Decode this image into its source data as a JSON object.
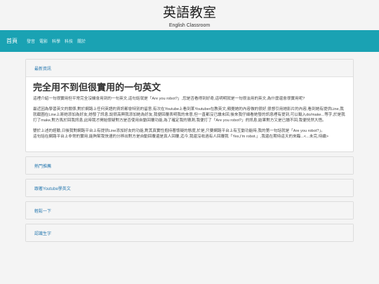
{
  "header": {
    "title": "英語教室",
    "subtitle": "English Classroom"
  },
  "nav": {
    "items": [
      "首頁",
      "發音",
      "電影",
      "科學",
      "科技",
      "關於"
    ]
  },
  "latest": {
    "heading": "最新資訊",
    "post_title": "完全用不到但很實用的一句英文",
    "paragraphs": [
      "這裡介紹一句很實用但平常完全沒機會用到的一句英文,這句話就是「Are you robot?」,您是否看得到好奇,這明明就是一句很淡用的英文,為什麼還會很實用呢?",
      "最近因為學習英文的關係,對於網路上任何英語的資訊都會特別的留意,有次在Youtube上看到某Youtuber在教英文,頻覺她的內容做的很好,很想引用她影片的內容,看到她有提供Line,我就截圖在Line上將她添加為好友,她發了訊息,說很高興我添加她為好友,我便回覆表明我的來意,但一直都沒已讀未回,後來我仔細看她發的訊息裡有提到,可以輸入do/make...等字,於是我打了make,對方馬於回我訊息,此時我才開始懷疑對方是否使用自動回覆功能,為了確定我的猜測,我便打了「Are you robot?」的訊息,結果對方又是已讀不回,我便恍然大悟。",
      "鑒於上述的經驗,日後我對網路平台上有提供Line添加好友的功能,對其真實性抱持著懷疑的態度,於是,只要網路平台上有互動功能時,我的第一句話就是「Are you robot?」。",
      "這句話在網路平台上非常的實用,能夠幫我快速的分辨出對方是自動回覆還是真人回覆,迄今,我還沒收過有人回覆我「Yes,I'm robot.」,我還在期待這天的來臨..."
    ],
    "read_more": "<...未完,待續>"
  },
  "panels": [
    "熱門推薦",
    "跟著Youtube學英文",
    "輕鬆一下",
    "認識生字"
  ]
}
